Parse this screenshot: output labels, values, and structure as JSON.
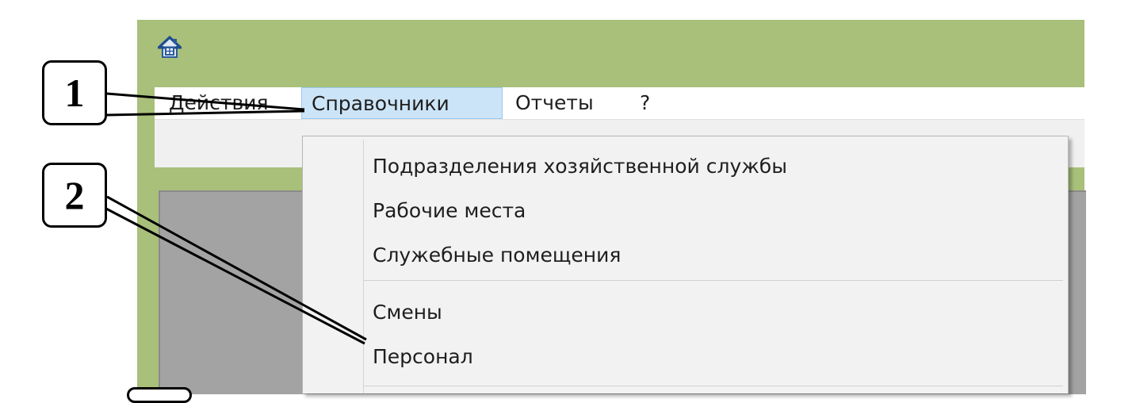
{
  "window": {
    "icon": "home-app-icon",
    "background": "#a8c07a"
  },
  "menubar": {
    "items": [
      "Действия",
      "Справочники",
      "Отчеты",
      "?"
    ],
    "active": "Справочники",
    "active_bg": "#cce4f7"
  },
  "dropdown": {
    "items": [
      "Подразделения хозяйственной службы",
      "Рабочие места",
      "Служебные помещения",
      "Смены",
      "Персонал"
    ]
  },
  "callouts": {
    "first": "1",
    "second": "2"
  }
}
